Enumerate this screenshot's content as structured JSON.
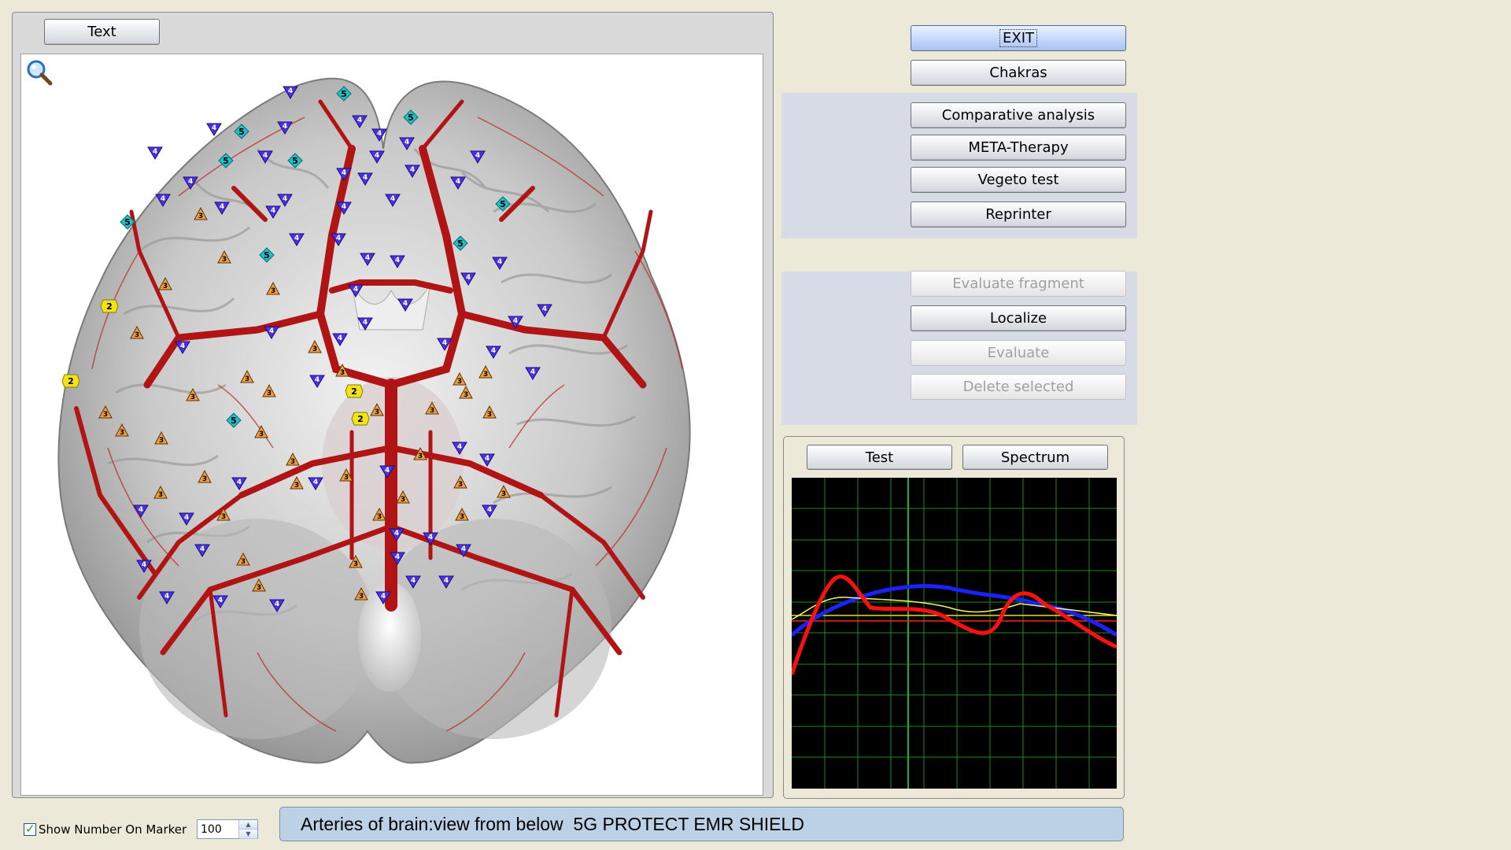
{
  "viewer": {
    "text_button": "Text",
    "zoom_icon": "magnifier-icon",
    "image_name": "brain-arteries-inferior-view",
    "markers": [
      {
        "n": "5",
        "kind": "diamond"
      },
      {
        "n": "4",
        "kind": "triangle"
      },
      {
        "n": "3",
        "kind": "triangle-up"
      },
      {
        "n": "2",
        "kind": "hexagon"
      }
    ]
  },
  "right_panel": {
    "exit": "EXIT",
    "chakras": "Chakras",
    "comparative_analysis": "Comparative analysis",
    "meta_therapy": "META-Therapy",
    "vegeto_test": "Vegeto test",
    "reprinter": "Reprinter",
    "evaluate_fragment": "Evaluate fragment",
    "localize": "Localize",
    "evaluate": "Evaluate",
    "delete_selected": "Delete selected"
  },
  "spectrum": {
    "test_button": "Test",
    "spectrum_button": "Spectrum",
    "series_colors": {
      "red": "#ff1010",
      "blue": "#1a22ff",
      "yellow": "#f4f46a"
    }
  },
  "bottom": {
    "show_number_label": "Show Number On Marker",
    "show_number_checked": true,
    "zoom_value": "100",
    "caption": "Arteries of brain:view from below  5G PROTECT EMR SHIELD"
  },
  "colors": {
    "background": "#ece9d8",
    "caption_bg": "#bcd0e6",
    "artery_red": "#b01414"
  }
}
